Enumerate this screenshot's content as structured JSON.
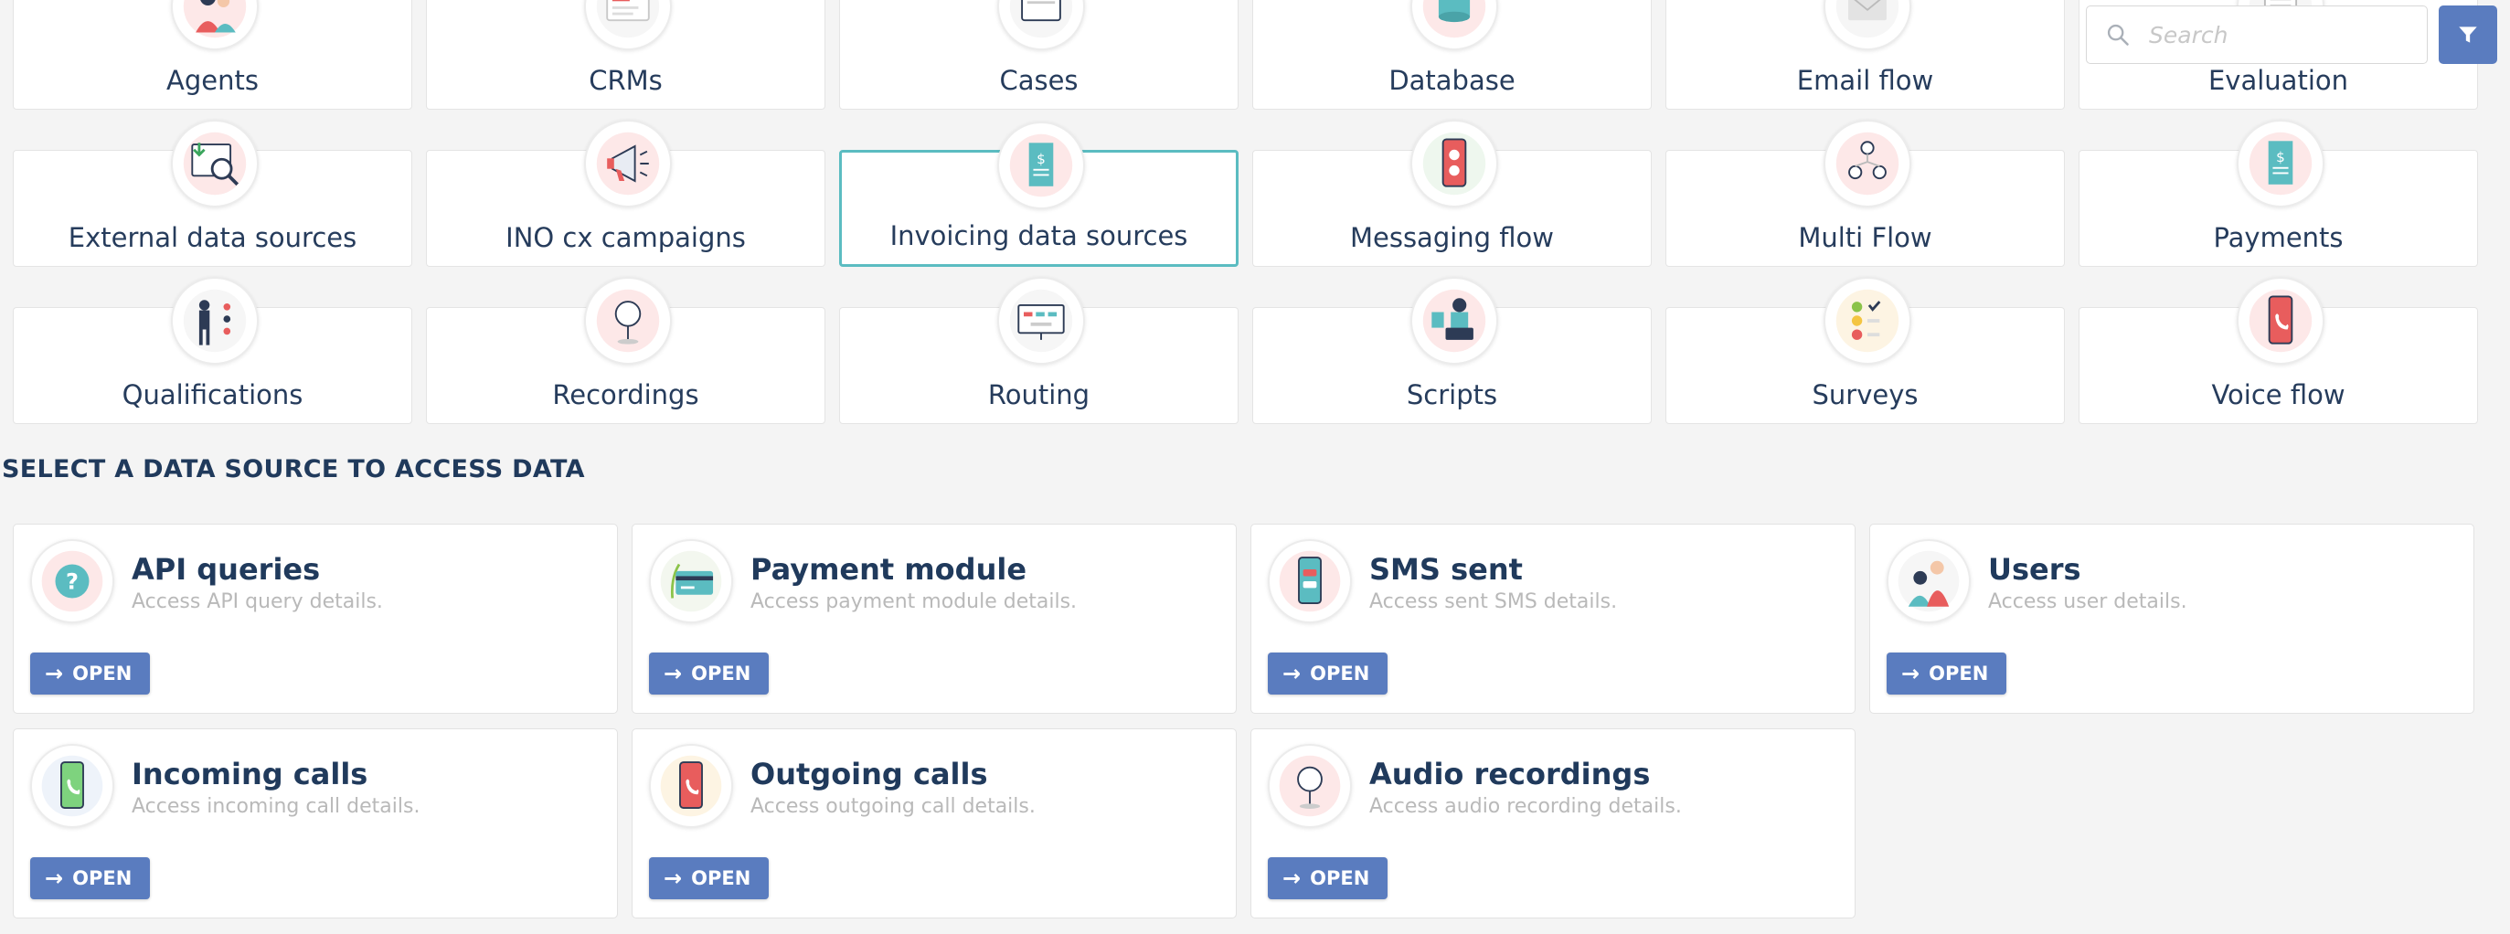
{
  "search": {
    "placeholder": "Search"
  },
  "categories": [
    {
      "label": "Agents",
      "icon": "agents-icon"
    },
    {
      "label": "CRMs",
      "icon": "crm-icon"
    },
    {
      "label": "Cases",
      "icon": "cases-icon"
    },
    {
      "label": "Database",
      "icon": "database-icon"
    },
    {
      "label": "Email flow",
      "icon": "email-icon"
    },
    {
      "label": "Evaluation",
      "icon": "evaluation-icon"
    },
    {
      "label": "External data sources",
      "icon": "external-data-icon"
    },
    {
      "label": "INO cx campaigns",
      "icon": "megaphone-icon"
    },
    {
      "label": "Invoicing data sources",
      "icon": "invoice-icon",
      "selected": true
    },
    {
      "label": "Messaging flow",
      "icon": "messaging-icon"
    },
    {
      "label": "Multi Flow",
      "icon": "multi-flow-icon"
    },
    {
      "label": "Payments",
      "icon": "payments-icon"
    },
    {
      "label": "Qualifications",
      "icon": "qualifications-icon"
    },
    {
      "label": "Recordings",
      "icon": "microphone-icon"
    },
    {
      "label": "Routing",
      "icon": "routing-icon"
    },
    {
      "label": "Scripts",
      "icon": "scripts-icon"
    },
    {
      "label": "Surveys",
      "icon": "surveys-icon"
    },
    {
      "label": "Voice flow",
      "icon": "voice-icon"
    }
  ],
  "section_title": "SELECT A DATA SOURCE TO ACCESS DATA",
  "open_label": "OPEN",
  "sources": [
    {
      "title": "API queries",
      "desc": "Access API query details.",
      "icon": "question-icon"
    },
    {
      "title": "Payment module",
      "desc": "Access payment module details.",
      "icon": "credit-card-icon"
    },
    {
      "title": "SMS sent",
      "desc": "Access sent SMS details.",
      "icon": "sms-phone-icon"
    },
    {
      "title": "Users",
      "desc": "Access user details.",
      "icon": "users-icon"
    },
    {
      "title": "Incoming calls",
      "desc": "Access incoming call details.",
      "icon": "incoming-call-icon"
    },
    {
      "title": "Outgoing calls",
      "desc": "Access outgoing call details.",
      "icon": "outgoing-call-icon"
    },
    {
      "title": "Audio recordings",
      "desc": "Access audio recording details.",
      "icon": "audio-recording-icon"
    }
  ],
  "colors": {
    "accent": "#5a7cbf",
    "selected_border": "#5bbcc1",
    "title": "#203a5c",
    "muted": "#b9b9b9"
  }
}
